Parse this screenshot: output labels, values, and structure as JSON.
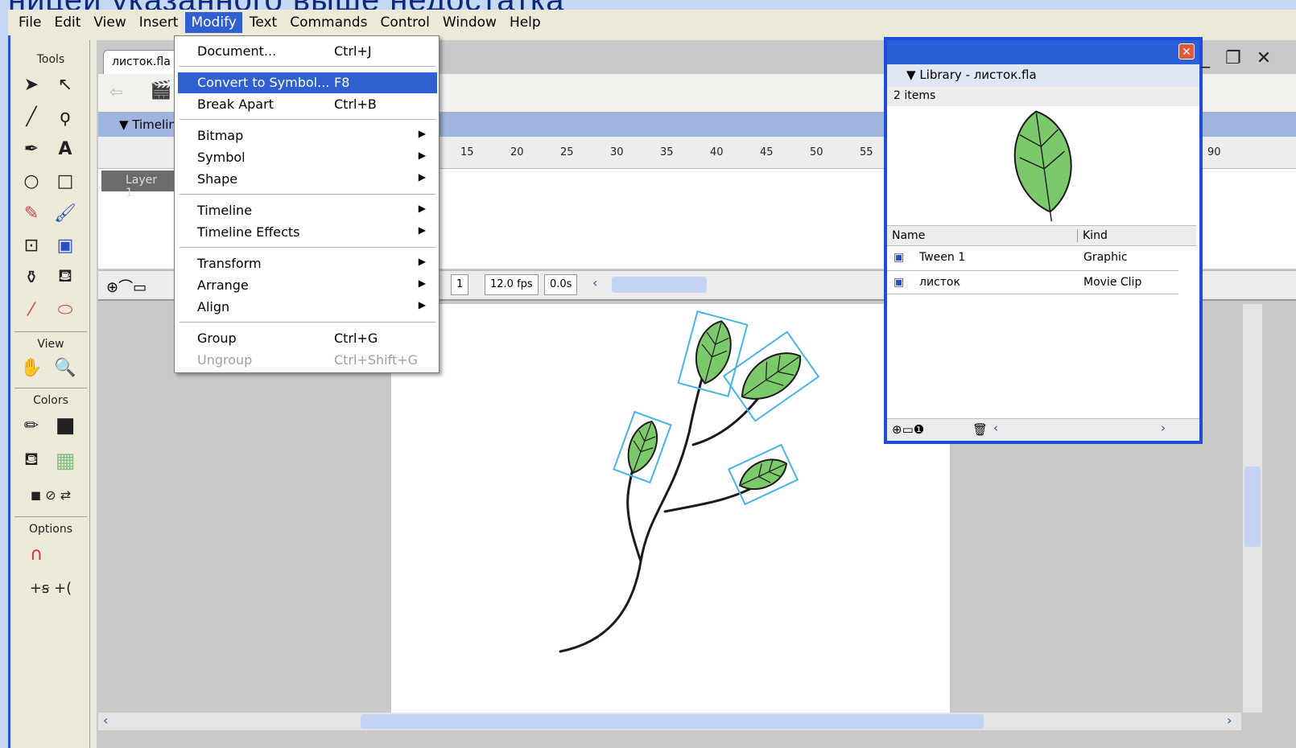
{
  "banner": "ницей указанного выше недостатка",
  "menubar": [
    "File",
    "Edit",
    "View",
    "Insert",
    "Modify",
    "Text",
    "Commands",
    "Control",
    "Window",
    "Help"
  ],
  "menubar_active": "Modify",
  "tools": {
    "title": "Tools",
    "view_label": "View",
    "colors_label": "Colors",
    "options_label": "Options"
  },
  "document": {
    "tab": "листок.fla",
    "timeline_label": "Timeline",
    "layer_label": "Layer 1",
    "ruler": [
      "15",
      "20",
      "25",
      "30",
      "35",
      "40",
      "45",
      "50",
      "55",
      "90"
    ],
    "frame": "1",
    "fps": "12.0 fps",
    "time": "0.0s"
  },
  "modify_menu": {
    "items": [
      {
        "label": "Document...",
        "shortcut": "Ctrl+J",
        "submenu": false,
        "state": "normal"
      },
      {
        "sep": true
      },
      {
        "label": "Convert to Symbol...",
        "shortcut": "F8",
        "submenu": false,
        "state": "selected"
      },
      {
        "label": "Break Apart",
        "shortcut": "Ctrl+B",
        "submenu": false,
        "state": "normal"
      },
      {
        "sep": true
      },
      {
        "label": "Bitmap",
        "shortcut": "",
        "submenu": true,
        "state": "normal"
      },
      {
        "label": "Symbol",
        "shortcut": "",
        "submenu": true,
        "state": "normal"
      },
      {
        "label": "Shape",
        "shortcut": "",
        "submenu": true,
        "state": "normal"
      },
      {
        "sep": true
      },
      {
        "label": "Timeline",
        "shortcut": "",
        "submenu": true,
        "state": "normal"
      },
      {
        "label": "Timeline Effects",
        "shortcut": "",
        "submenu": true,
        "state": "normal"
      },
      {
        "sep": true
      },
      {
        "label": "Transform",
        "shortcut": "",
        "submenu": true,
        "state": "normal"
      },
      {
        "label": "Arrange",
        "shortcut": "",
        "submenu": true,
        "state": "normal"
      },
      {
        "label": "Align",
        "shortcut": "",
        "submenu": true,
        "state": "normal"
      },
      {
        "sep": true
      },
      {
        "label": "Group",
        "shortcut": "Ctrl+G",
        "submenu": false,
        "state": "normal"
      },
      {
        "label": "Ungroup",
        "shortcut": "Ctrl+Shift+G",
        "submenu": false,
        "state": "disabled"
      }
    ]
  },
  "library": {
    "title": "Library - листок.fla",
    "count": "2 items",
    "columns": [
      "Name",
      "Kind"
    ],
    "rows": [
      {
        "name": "Tween 1",
        "kind": "Graphic"
      },
      {
        "name": "листок",
        "kind": "Movie Clip"
      }
    ]
  },
  "colors": {
    "accent": "#2f5fd0",
    "leaf_fill": "#7cc96b",
    "leaf_stroke": "#1b1b1b",
    "bbox": "#46b4e6"
  }
}
